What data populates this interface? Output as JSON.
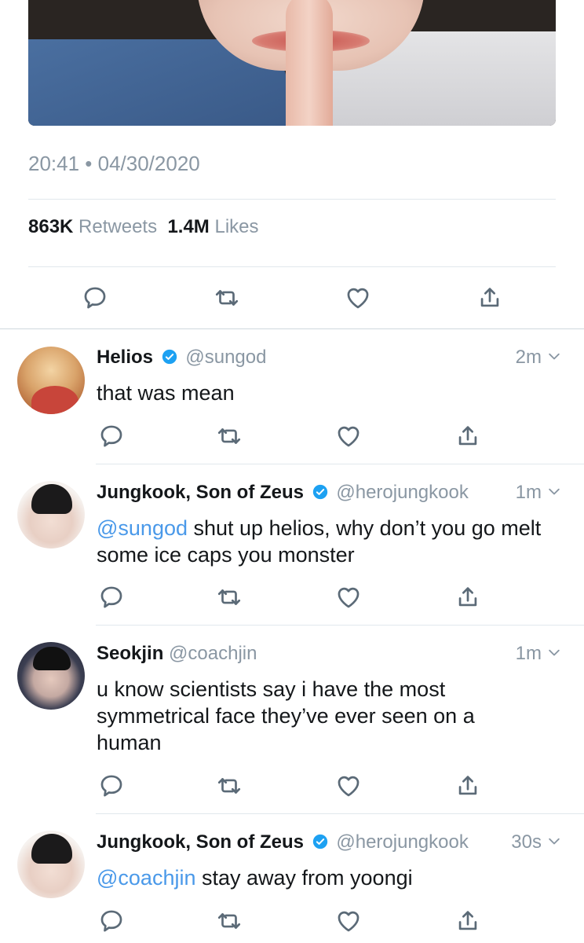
{
  "main_tweet": {
    "timestamp": "20:41 • 04/30/2020",
    "retweets_count": "863K",
    "retweets_label": "Retweets",
    "likes_count": "1.4M",
    "likes_label": "Likes"
  },
  "replies": [
    {
      "name": "Helios",
      "verified": true,
      "handle": "@sungod",
      "time": "2m",
      "mention": "",
      "text": "that was mean"
    },
    {
      "name": "Jungkook, Son of Zeus",
      "verified": true,
      "handle": "@herojungkook",
      "time": "1m",
      "mention": "@sungod",
      "text": " shut up helios, why don’t you go melt some ice caps you monster"
    },
    {
      "name": "Seokjin",
      "verified": false,
      "handle": "@coachjin",
      "time": "1m",
      "mention": "",
      "text": "u know scientists say i have the most symmetrical face they’ve ever seen on a human"
    },
    {
      "name": "Jungkook, Son of Zeus",
      "verified": true,
      "handle": "@herojungkook",
      "time": "30s",
      "mention": "@coachjin",
      "text": " stay away from yoongi"
    }
  ],
  "colors": {
    "accent": "#1da1f2",
    "mention": "#4a99e9",
    "muted": "#8a97a3",
    "text": "#14171a"
  },
  "icons": [
    "reply-icon",
    "retweet-icon",
    "like-icon",
    "share-icon",
    "verified-badge-icon",
    "chevron-down-icon"
  ]
}
